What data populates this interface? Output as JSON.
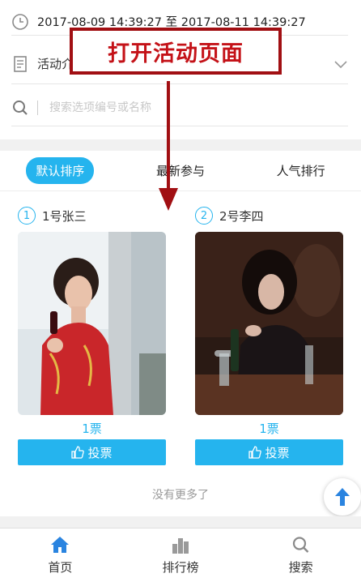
{
  "header": {
    "time_range": "2017-08-09 14:39:27 至 2017-08-11 14:39:27",
    "intro_label": "活动介绍",
    "search_placeholder": "搜索选项编号或名称"
  },
  "tabs": [
    "默认排序",
    "最新参与",
    "人气排行"
  ],
  "active_tab": 0,
  "entries": [
    {
      "number": "1",
      "name": "1号张三",
      "votes": "1票",
      "vote_label": "投票"
    },
    {
      "number": "2",
      "name": "2号李四",
      "votes": "1票",
      "vote_label": "投票"
    }
  ],
  "no_more": "没有更多了",
  "tabbar": [
    "首页",
    "排行榜",
    "搜索"
  ],
  "annotation": {
    "banner_text": "打开活动页面"
  },
  "colors": {
    "accent": "#25b4ee",
    "annotation_red": "#c41218",
    "page_gray": "#f1f1f1"
  },
  "icons": [
    "clock-icon",
    "document-icon",
    "chevron-down-icon",
    "search-icon",
    "thumbs-up-icon",
    "arrow-up-icon",
    "home-icon",
    "ranking-icon"
  ]
}
